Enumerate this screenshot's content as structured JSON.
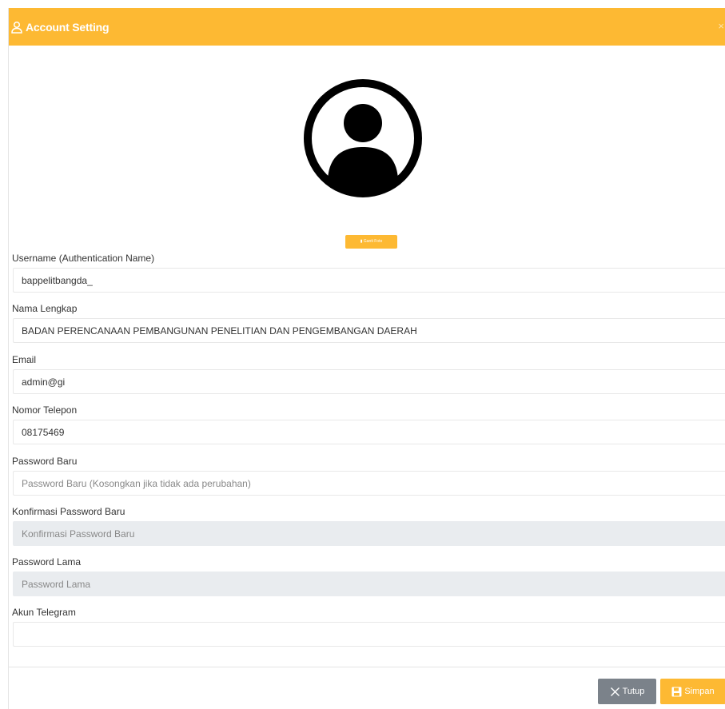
{
  "modal": {
    "title": "Account Setting",
    "close_glyph": "×",
    "header_icon": "user-icon",
    "header_color": "#fdb933"
  },
  "avatar": {
    "icon": "user-circle-icon"
  },
  "photo_button": {
    "label": "Ganti Foto",
    "icon": "folder-icon"
  },
  "fields": [
    {
      "label": "Username (Authentication Name)",
      "value": "bappelitbangda_",
      "placeholder": ""
    },
    {
      "label": "Nama Lengkap",
      "value": "BADAN PERENCANAAN PEMBANGUNAN PENELITIAN DAN PENGEMBANGAN DAERAH",
      "placeholder": ""
    },
    {
      "label": "Email",
      "value": "admin@gi",
      "placeholder": ""
    },
    {
      "label": "Nomor Telepon",
      "value": "08175469",
      "placeholder": ""
    },
    {
      "label": "Password Baru",
      "value": "",
      "placeholder": "Password Baru (Kosongkan jika tidak ada perubahan)"
    },
    {
      "label": "Konfirmasi Password Baru",
      "value": "",
      "placeholder": "Konfirmasi Password Baru"
    },
    {
      "label": "Password Lama",
      "value": "",
      "placeholder": "Password Lama"
    },
    {
      "label": "Akun Telegram",
      "value": "",
      "placeholder": ""
    }
  ],
  "footer": {
    "close_label": "Tutup",
    "close_icon": "close-icon",
    "save_label": "Simpan",
    "save_icon": "save-icon",
    "close_color": "#7b828a",
    "save_color": "#fdb933"
  }
}
